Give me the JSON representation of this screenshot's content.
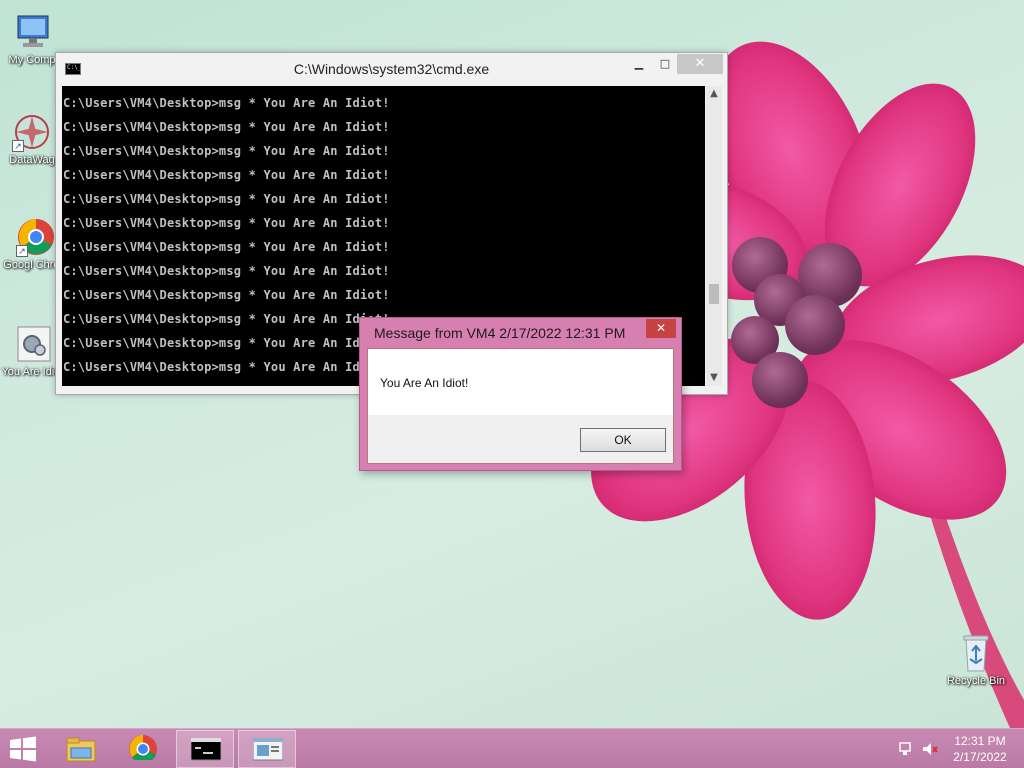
{
  "desktop": {
    "icons": [
      {
        "label": "My Comp"
      },
      {
        "label": "DataWag"
      },
      {
        "label": "Googl Chrom"
      },
      {
        "label": "You Are Idiot!"
      },
      {
        "label": "Recycle Bin"
      }
    ]
  },
  "cmd_window": {
    "title": "C:\\Windows\\system32\\cmd.exe",
    "lines": [
      "C:\\Users\\VM4\\Desktop>msg * You Are An Idiot!",
      "C:\\Users\\VM4\\Desktop>msg * You Are An Idiot!",
      "C:\\Users\\VM4\\Desktop>msg * You Are An Idiot!",
      "C:\\Users\\VM4\\Desktop>msg * You Are An Idiot!",
      "C:\\Users\\VM4\\Desktop>msg * You Are An Idiot!",
      "C:\\Users\\VM4\\Desktop>msg * You Are An Idiot!",
      "C:\\Users\\VM4\\Desktop>msg * You Are An Idiot!",
      "C:\\Users\\VM4\\Desktop>msg * You Are An Idiot!",
      "C:\\Users\\VM4\\Desktop>msg * You Are An Idiot!",
      "C:\\Users\\VM4\\Desktop>msg * You Are An Idiot!",
      "C:\\Users\\VM4\\Desktop>msg * You Are An Idiot!",
      "C:\\Users\\VM4\\Desktop>msg * You Are An Idiot!"
    ],
    "minimize_glyph": "▁",
    "maximize_glyph": "□",
    "close_glyph": "✕"
  },
  "message_dialog": {
    "title": "Message from VM4 2/17/2022 12:31 PM",
    "text": "You Are An Idiot!",
    "ok_label": "OK",
    "close_glyph": "✕"
  },
  "taskbar": {
    "items": [
      "start-icon",
      "file-explorer-icon",
      "chrome-icon",
      "cmd-icon",
      "message-window-icon"
    ],
    "active_item": "message-window-icon",
    "time": "12:31 PM",
    "date": "2/17/2022"
  },
  "colors": {
    "taskbar": "#c88ab4",
    "dialog_frame": "#d87fb2",
    "close_red": "#c74343",
    "console_bg": "#000000",
    "console_text": "#c0c0c0"
  }
}
